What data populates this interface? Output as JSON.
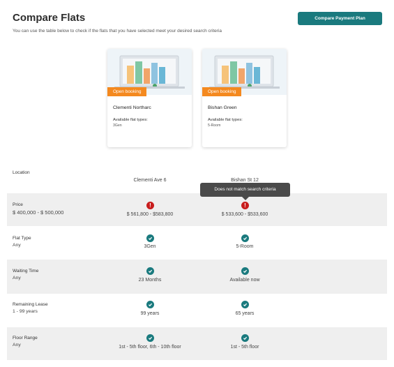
{
  "header": {
    "title": "Compare Flats",
    "subtitle": "You can use the table below to check if the flats that you have selected meet your desired search criteria",
    "cta_label": "Compare Payment Plan"
  },
  "cards": [
    {
      "badge": "Open booking",
      "name": "Clementi Northarc",
      "flat_types_label": "Available flat types:",
      "flat_types_value": "3Gen"
    },
    {
      "badge": "Open booking",
      "name": "Bishan Green",
      "flat_types_label": "Available flat types:",
      "flat_types_value": "5-Room"
    }
  ],
  "rows": {
    "location": {
      "label": "Location",
      "col1": "Clementi Ave 6",
      "col2": "Bishan St 12"
    },
    "price": {
      "label": "Price",
      "criteria": "$ 400,000 - $ 500,000",
      "col1": "$ 561,800 - $583,800",
      "col2": "$ 533,600 - $533,600"
    },
    "flat_type": {
      "label": "Flat Type",
      "criteria": "Any",
      "col1": "3Gen",
      "col2": "5-Room"
    },
    "waiting_time": {
      "label": "Waiting Time",
      "criteria": "Any",
      "col1": "23 Months",
      "col2": "Available now"
    },
    "remaining_lease": {
      "label": "Remaining Lease",
      "criteria": "1 - 99 years",
      "col1": "99 years",
      "col2": "65 years"
    },
    "floor_range": {
      "label": "Floor Range",
      "criteria": "Any",
      "col1": "1st - 5th floor, 6th - 10th floor",
      "col2": "1st - 5th floor"
    }
  },
  "tooltip": "Does not match search criteria",
  "colors": {
    "primary": "#1a7a7e",
    "badge": "#f4891f",
    "warning": "#c81d1d"
  },
  "icons": {
    "match": "check-circle-icon",
    "mismatch": "exclamation-circle-icon"
  }
}
